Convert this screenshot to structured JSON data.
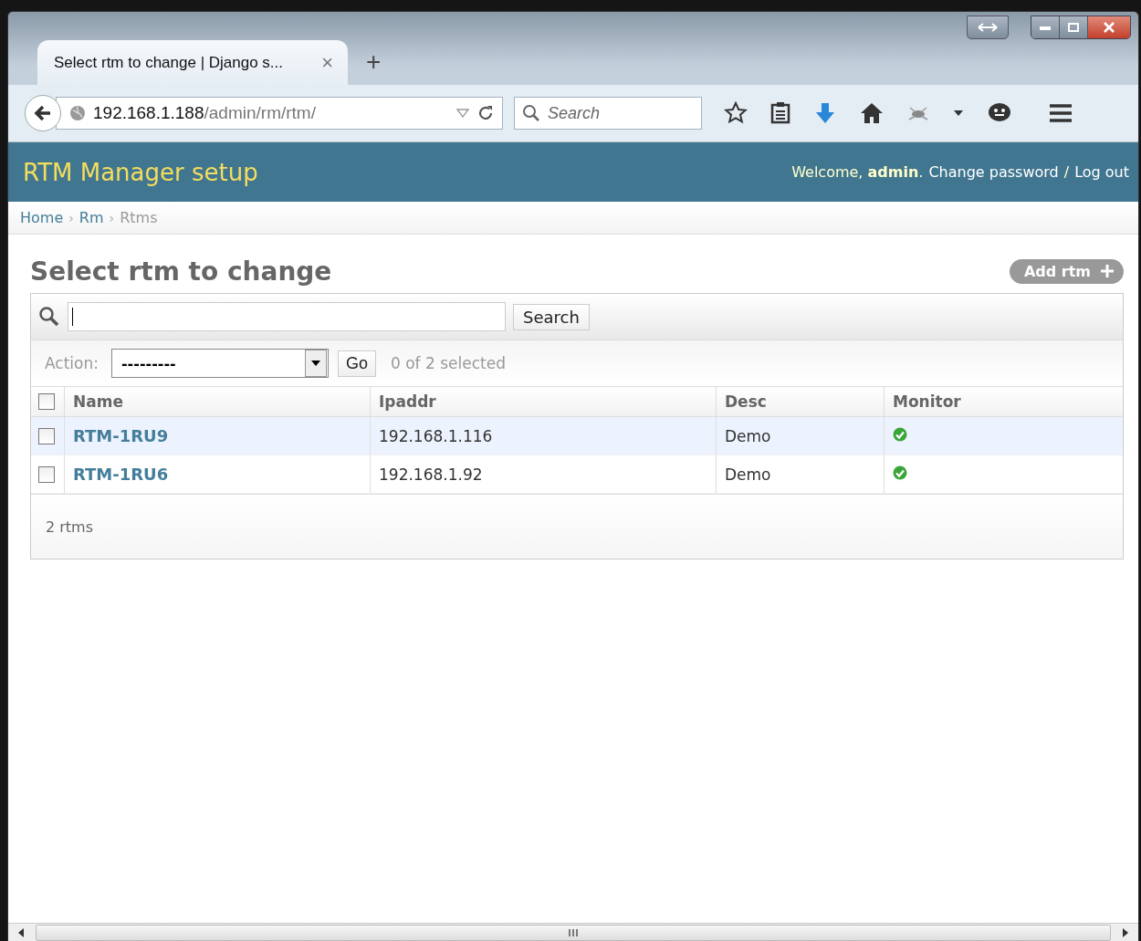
{
  "browser": {
    "tab": {
      "title": "Select rtm to change | Django s...",
      "close": "×"
    },
    "new_tab": "+",
    "url": {
      "host": "192.168.1.188",
      "path": "/admin/rm/rtm/"
    },
    "search": {
      "placeholder": "Search"
    }
  },
  "header": {
    "title": "RTM Manager setup",
    "welcome": "Welcome, **admin**.",
    "links": [
      "Change password",
      "Log out"
    ],
    "separator": "/"
  },
  "breadcrumbs": {
    "separator": "›",
    "items": [
      {
        "label": "Home",
        "link": true
      },
      {
        "label": "Rm",
        "link": true
      },
      {
        "label": "Rtms",
        "link": false
      }
    ]
  },
  "content": {
    "title": "Select rtm to change",
    "add_button": "Add rtm",
    "search_button": "Search",
    "action": {
      "label": "Action:",
      "value": "---------",
      "go": "Go",
      "counter": "0 of 2 selected"
    },
    "select_all": {
      "checked": false
    },
    "columns": [
      "Name",
      "Ipaddr",
      "Desc",
      "Monitor"
    ],
    "rows": [
      {
        "name": "RTM-1RU9",
        "ipaddr": "192.168.1.116",
        "desc": "Demo",
        "monitor": true,
        "checked": false,
        "hovered": true
      },
      {
        "name": "RTM-1RU6",
        "ipaddr": "192.168.1.92",
        "desc": "Demo",
        "monitor": true,
        "checked": false,
        "hovered": false
      }
    ],
    "paginator": "2 rtms"
  }
}
